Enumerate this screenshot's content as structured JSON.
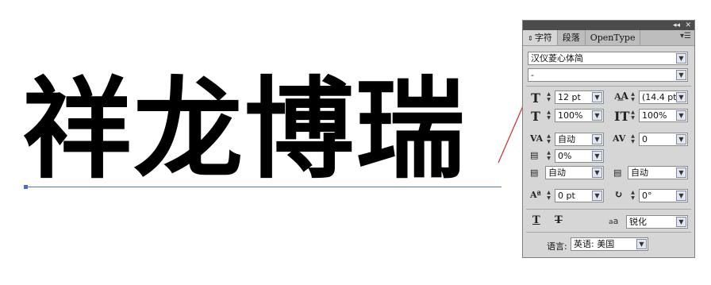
{
  "artwork": {
    "text": "祥龙博瑞"
  },
  "panel": {
    "tabs": [
      "字符",
      "段落",
      "OpenType"
    ],
    "font_family": "汉仪菱心体简",
    "font_style": "-",
    "font_size": "12 pt",
    "leading": "(14.4 pt)",
    "vertical_scale": "100%",
    "horizontal_scale": "100%",
    "kerning": "自动",
    "tracking": "0",
    "tsume": "0%",
    "aki_left": "自动",
    "aki_right": "自动",
    "baseline_shift": "0 pt",
    "rotation": "0°",
    "antialias_label": "a",
    "antialias": "锐化",
    "language_label": "语言:",
    "language": "英语: 美国"
  },
  "colors": {
    "annotation_arrow": "#d2383c",
    "baseline": "#5a78c8"
  }
}
